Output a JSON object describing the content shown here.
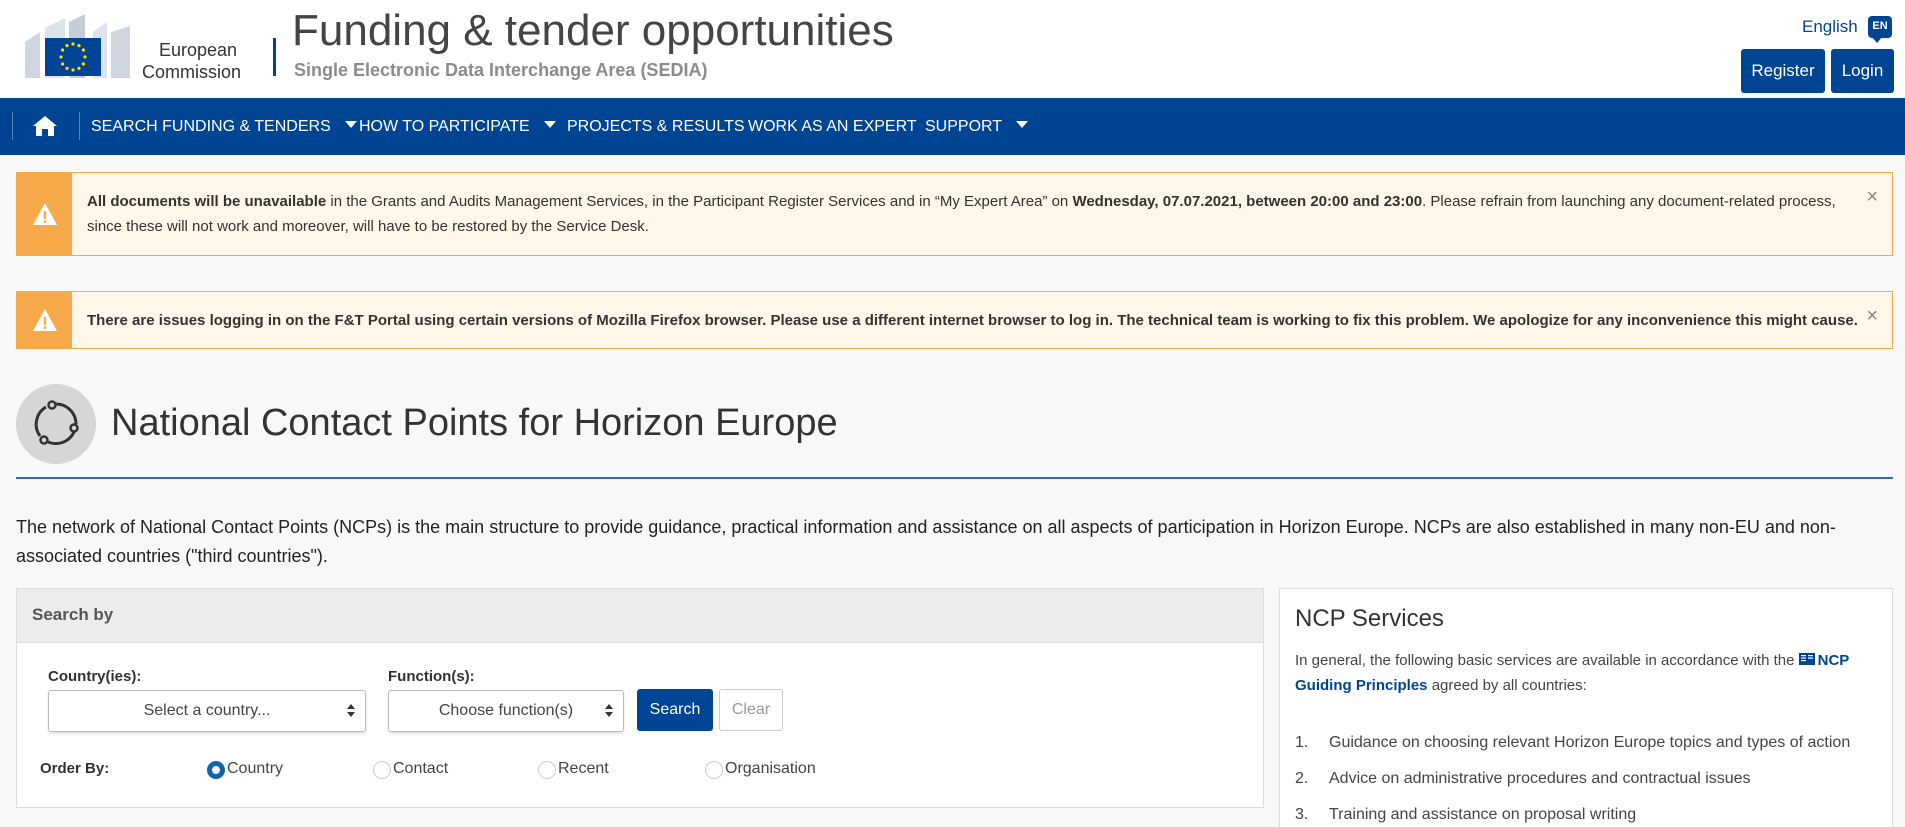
{
  "header": {
    "logo_line1": "European",
    "logo_line2": "Commission",
    "title": "Funding & tender opportunities",
    "subtitle": "Single Electronic Data Interchange Area (SEDIA)",
    "language": "English",
    "language_code": "EN",
    "register_label": "Register",
    "login_label": "Login"
  },
  "nav": {
    "items": [
      {
        "label": "SEARCH FUNDING & TENDERS"
      },
      {
        "label": "HOW TO PARTICIPATE"
      },
      {
        "label": "PROJECTS & RESULTS"
      },
      {
        "label": "WORK AS AN EXPERT"
      },
      {
        "label": "SUPPORT"
      }
    ]
  },
  "alerts": [
    {
      "bold_lead": "All documents will be unavailable",
      "text_mid": " in the Grants and Audits Management Services, in the Participant Register Services and in “My Expert Area” on ",
      "bold_date": "Wednesday, 07.07.2021, between 20:00 and 23:00",
      "text_end": ". Please refrain from launching any document-related process, since these will not work and moreover, will have to be restored by the Service Desk.",
      "close": "×"
    },
    {
      "text": "There are issues logging in on the F&T Portal using certain versions of Mozilla Firefox browser. Please use a different internet browser to log in. The technical team is working to fix this problem. We apologize for any inconvenience this might cause.",
      "close": "×"
    }
  ],
  "page": {
    "title": "National Contact Points for Horizon Europe",
    "intro": "The network of National Contact Points (NCPs) is the main structure to provide guidance, practical information and assistance on all aspects of participation in Horizon Europe. NCPs are also established in many non-EU and non-associated countries (\"third countries\")."
  },
  "search": {
    "heading": "Search by",
    "country_label": "Country(ies):",
    "country_placeholder": "Select a country...",
    "function_label": "Function(s):",
    "function_placeholder": "Choose function(s)",
    "search_label": "Search",
    "clear_label": "Clear",
    "order_label": "Order By:",
    "order_options": [
      {
        "label": "Country",
        "selected": true
      },
      {
        "label": "Contact",
        "selected": false
      },
      {
        "label": "Recent",
        "selected": false
      },
      {
        "label": "Organisation",
        "selected": false
      }
    ]
  },
  "ncp_services": {
    "title": "NCP Services",
    "intro_before": "In general, the following basic services are available in accordance with the ",
    "link_text": "NCP Guiding Principles",
    "intro_after": " agreed by all countries:",
    "list": [
      {
        "num": "1.",
        "text": "Guidance on choosing relevant Horizon Europe topics and types of action"
      },
      {
        "num": "2.",
        "text": "Advice on administrative procedures and contractual issues"
      },
      {
        "num": "3.",
        "text": "Training and assistance on proposal writing"
      }
    ]
  },
  "colors": {
    "brand_blue": "#004494",
    "warning_orange": "#f5a948",
    "alert_bg": "#fdf6e9"
  }
}
